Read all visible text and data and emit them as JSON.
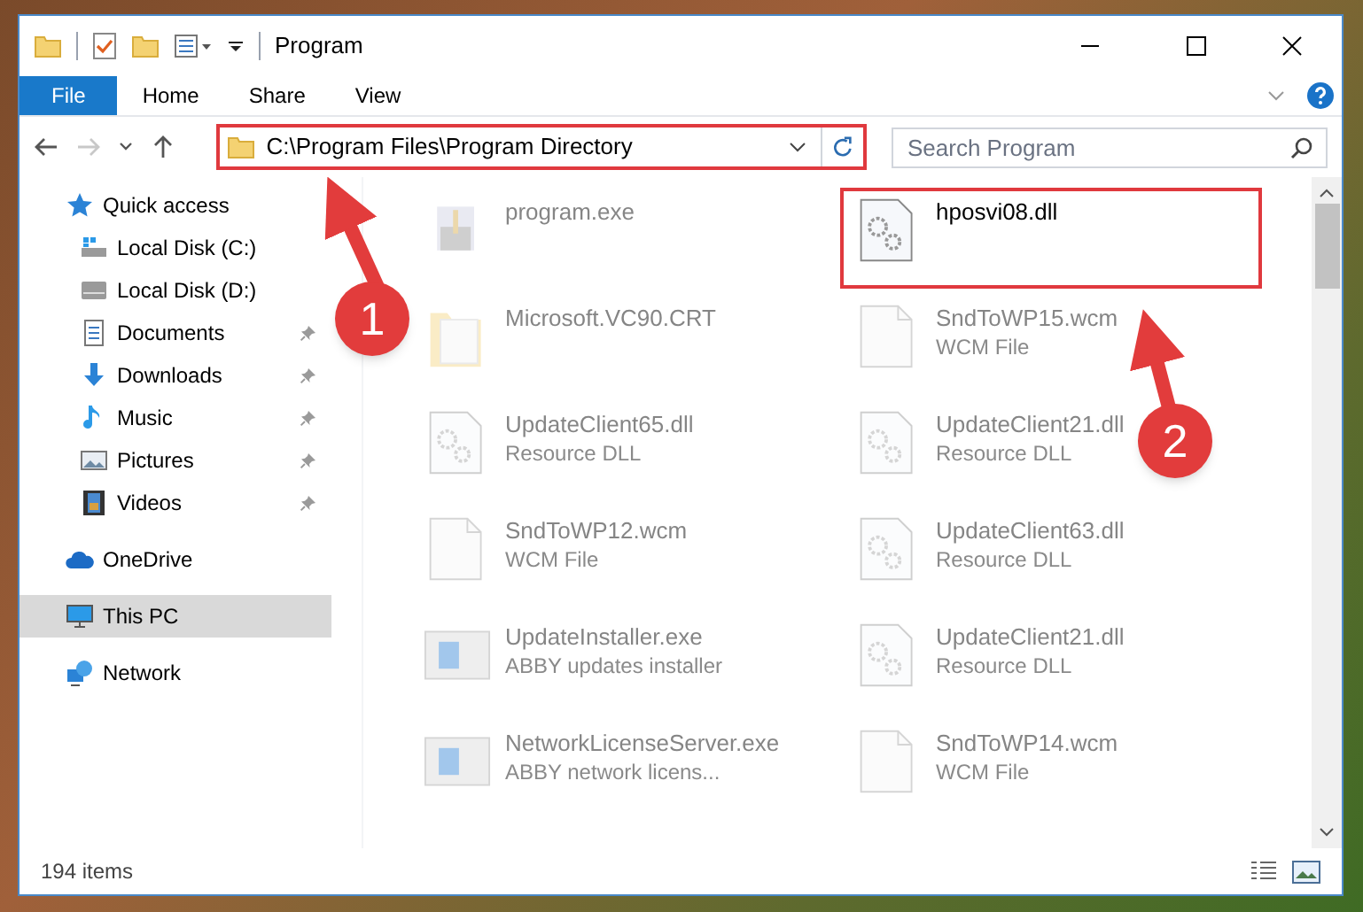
{
  "window": {
    "title": "Program"
  },
  "ribbon_tabs": [
    {
      "label": "File",
      "selected": true
    },
    {
      "label": "Home",
      "selected": false
    },
    {
      "label": "Share",
      "selected": false
    },
    {
      "label": "View",
      "selected": false
    }
  ],
  "nav_buttons": [
    {
      "kind": "back",
      "disabled": false
    },
    {
      "kind": "forward",
      "disabled": true
    },
    {
      "kind": "recent",
      "disabled": false
    },
    {
      "kind": "up",
      "disabled": false
    }
  ],
  "address": {
    "path": "C:\\Program Files\\Program Directory",
    "highlighted": true
  },
  "search": {
    "placeholder": "Search Program"
  },
  "sidebar": {
    "items": [
      {
        "label": "Quick access",
        "kind": "quick",
        "selected": false,
        "children": [
          {
            "label": "Local Disk (C:)",
            "kind": "disk-c",
            "selected": false,
            "pinned": false
          },
          {
            "label": "Local Disk (D:)",
            "kind": "disk",
            "selected": false,
            "pinned": false
          },
          {
            "label": "Documents",
            "kind": "documents",
            "selected": false,
            "pinned": true
          },
          {
            "label": "Downloads",
            "kind": "downloads",
            "selected": false,
            "pinned": true
          },
          {
            "label": "Music",
            "kind": "music",
            "selected": false,
            "pinned": true
          },
          {
            "label": "Pictures",
            "kind": "pictures",
            "selected": false,
            "pinned": true
          },
          {
            "label": "Videos",
            "kind": "videos",
            "selected": false,
            "pinned": true
          }
        ]
      },
      {
        "label": "OneDrive",
        "kind": "cloud",
        "selected": false
      },
      {
        "label": "This PC",
        "kind": "pc",
        "selected": true
      },
      {
        "label": "Network",
        "kind": "network",
        "selected": false
      }
    ]
  },
  "files": [
    {
      "name": "program.exe",
      "kind": "exe",
      "faded": true,
      "highlighted": false
    },
    {
      "name": "hposvi08.dll",
      "kind": "dll",
      "faded": false,
      "highlighted": true
    },
    {
      "name": "Microsoft.VC90.CRT",
      "kind": "folder",
      "faded": true,
      "highlighted": false
    },
    {
      "name": "SndToWP15.wcm",
      "type": "WCM File",
      "kind": "wcm",
      "faded": true,
      "highlighted": false
    },
    {
      "name": "UpdateClient65.dll",
      "type": "Resource DLL",
      "kind": "dll",
      "faded": true,
      "highlighted": false
    },
    {
      "name": "UpdateClient21.dll",
      "type": "Resource DLL",
      "kind": "dll",
      "faded": true,
      "highlighted": false
    },
    {
      "name": "SndToWP12.wcm",
      "type": "WCM File",
      "kind": "wcm",
      "faded": true,
      "highlighted": false
    },
    {
      "name": "UpdateClient63.dll",
      "type": "Resource DLL",
      "kind": "dll",
      "faded": true,
      "highlighted": false
    },
    {
      "name": "UpdateInstaller.exe",
      "type": "ABBY updates installer",
      "kind": "installer",
      "faded": true,
      "highlighted": false
    },
    {
      "name": "UpdateClient21.dll",
      "type": "Resource DLL",
      "kind": "dll",
      "faded": true,
      "highlighted": false
    },
    {
      "name": "NetworkLicenseServer.exe",
      "type": "ABBY network licens...",
      "kind": "installer",
      "faded": true,
      "highlighted": false
    },
    {
      "name": "SndToWP14.wcm",
      "type": "WCM File",
      "kind": "wcm",
      "faded": true,
      "highlighted": false
    }
  ],
  "status_bar": {
    "count": "194 items"
  },
  "annotations": [
    {
      "label": "1"
    },
    {
      "label": "2"
    }
  ]
}
